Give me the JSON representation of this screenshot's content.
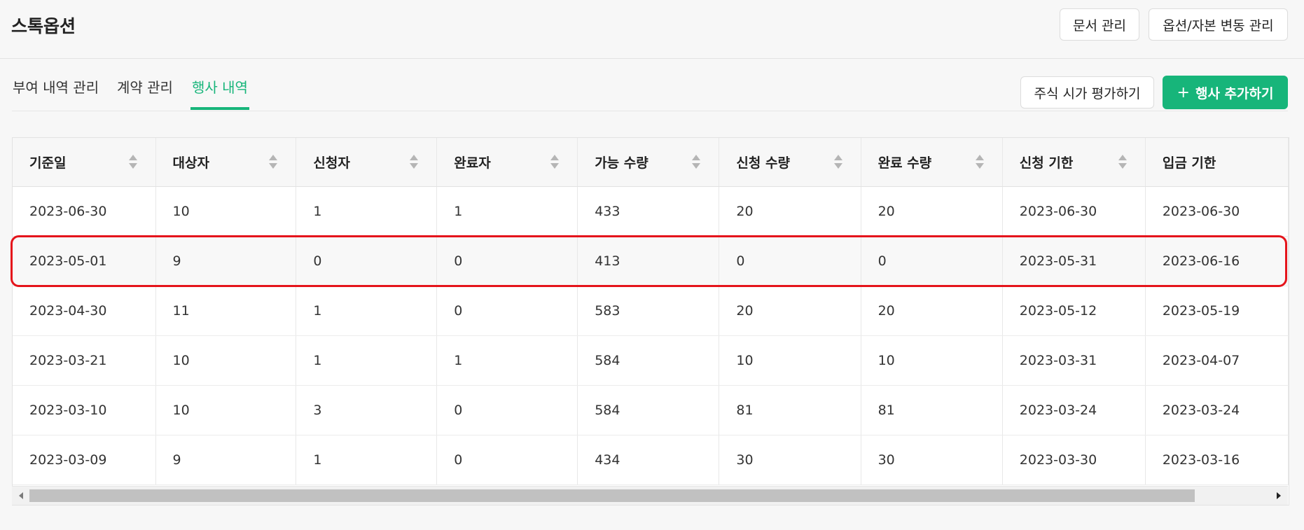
{
  "header": {
    "title": "스톡옵션",
    "docs_button": "문서 관리",
    "options_button": "옵션/자본 변동 관리"
  },
  "tabs": [
    {
      "label": "부여 내역 관리",
      "active": false
    },
    {
      "label": "계약 관리",
      "active": false
    },
    {
      "label": "행사 내역",
      "active": true
    }
  ],
  "actions": {
    "valuation_button": "주식 시가 평가하기",
    "add_button": "행사 추가하기",
    "add_icon": "plus-icon"
  },
  "colors": {
    "accent": "#17b57a",
    "highlight_border": "#e5141b"
  },
  "table": {
    "columns": [
      "기준일",
      "대상자",
      "신청자",
      "완료자",
      "가능 수량",
      "신청 수량",
      "완료 수량",
      "신청 기한",
      "입금 기한"
    ],
    "rows": [
      [
        "2023-06-30",
        "10",
        "1",
        "1",
        "433",
        "20",
        "20",
        "2023-06-30",
        "2023-06-30"
      ],
      [
        "2023-05-01",
        "9",
        "0",
        "0",
        "413",
        "0",
        "0",
        "2023-05-31",
        "2023-06-16"
      ],
      [
        "2023-04-30",
        "11",
        "1",
        "0",
        "583",
        "20",
        "20",
        "2023-05-12",
        "2023-05-19"
      ],
      [
        "2023-03-21",
        "10",
        "1",
        "1",
        "584",
        "10",
        "10",
        "2023-03-31",
        "2023-04-07"
      ],
      [
        "2023-03-10",
        "10",
        "3",
        "0",
        "584",
        "81",
        "81",
        "2023-03-24",
        "2023-03-24"
      ],
      [
        "2023-03-09",
        "9",
        "1",
        "0",
        "434",
        "30",
        "30",
        "2023-03-30",
        "2023-03-16"
      ]
    ],
    "highlighted_row": 1
  }
}
